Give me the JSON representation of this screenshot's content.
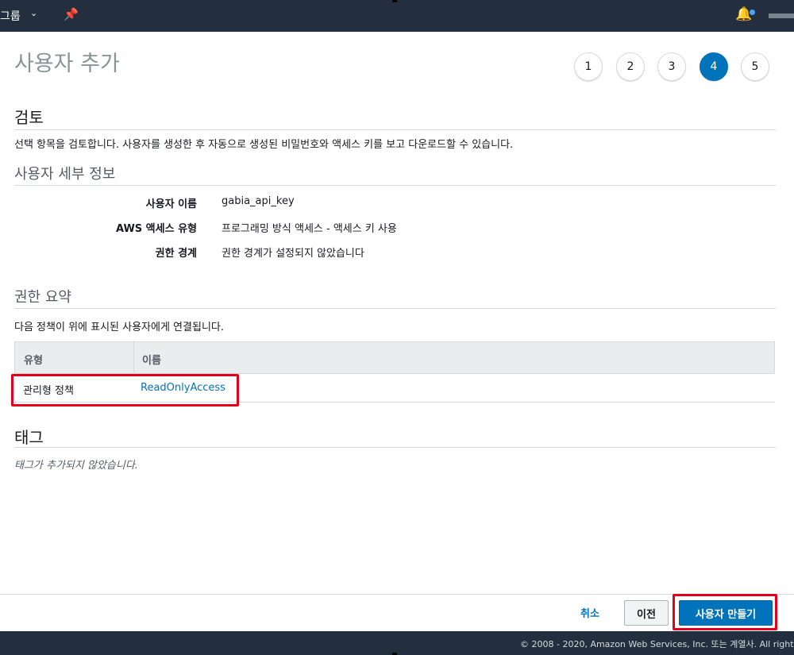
{
  "topbar": {
    "group_label": "그룹",
    "chevron_icon": "chevron-down-icon",
    "pin_icon": "pin-icon",
    "bell_icon": "bell-icon",
    "notification_color": "#4aa3ff"
  },
  "page": {
    "title": "사용자 추가",
    "steps": [
      "1",
      "2",
      "3",
      "4",
      "5"
    ],
    "active_step": "4"
  },
  "review": {
    "heading": "검토",
    "description": "선택 항목을 검토합니다. 사용자를 생성한 후 자동으로 생성된 비밀번호와 액세스 키를 보고 다운로드할 수 있습니다."
  },
  "user_details": {
    "heading": "사용자 세부 정보",
    "rows": [
      {
        "label": "사용자 이름",
        "value": "gabia_api_key"
      },
      {
        "label": "AWS 액세스 유형",
        "value": "프로그래밍 방식 액세스 - 액세스 키 사용"
      },
      {
        "label": "권한 경계",
        "value": "권한 경계가 설정되지 않았습니다"
      }
    ]
  },
  "permissions": {
    "heading": "권한 요약",
    "description": "다음 정책이 위에 표시된 사용자에게 연결됩니다.",
    "columns": [
      "유형",
      "이름"
    ],
    "rows": [
      {
        "type": "관리형 정책",
        "name": "ReadOnlyAccess"
      }
    ]
  },
  "tags": {
    "heading": "태그",
    "empty_text": "태그가 추가되지 않았습니다."
  },
  "actions": {
    "cancel": "취소",
    "previous": "이전",
    "create": "사용자 만들기"
  },
  "footer": {
    "copyright": "© 2008 - 2020, Amazon Web Services, Inc. 또는 계열사. All right"
  },
  "colors": {
    "accent": "#0073bb",
    "highlight": "#e2001a",
    "nav": "#232f3e"
  }
}
